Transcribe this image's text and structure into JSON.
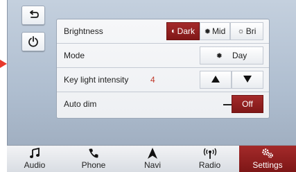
{
  "colors": {
    "accent": "#8f1f1f",
    "pointer": "#e8392c"
  },
  "side_buttons": [
    {
      "name": "back",
      "icon": "back-arrow-icon"
    },
    {
      "name": "power",
      "icon": "power-icon"
    }
  ],
  "settings": {
    "brightness": {
      "label": "Brightness",
      "options": [
        {
          "label": "Dark",
          "icon": "half-circle-icon",
          "selected": true
        },
        {
          "label": "Mid",
          "icon": "sun-medium-icon",
          "selected": false
        },
        {
          "label": "Bri",
          "icon": "sun-bright-icon",
          "selected": false
        }
      ]
    },
    "mode": {
      "label": "Mode",
      "value": "Day",
      "icon": "sun-icon"
    },
    "key_light": {
      "label": "Key light intensity",
      "value": "4"
    },
    "auto_dim": {
      "label": "Auto dim",
      "value": "Off"
    }
  },
  "nav": [
    {
      "label": "Audio",
      "icon": "music-note-icon",
      "active": false
    },
    {
      "label": "Phone",
      "icon": "phone-icon",
      "active": false
    },
    {
      "label": "Navi",
      "icon": "navigation-arrow-icon",
      "active": false
    },
    {
      "label": "Radio",
      "icon": "antenna-icon",
      "active": false
    },
    {
      "label": "Settings",
      "icon": "gears-icon",
      "active": true
    }
  ]
}
